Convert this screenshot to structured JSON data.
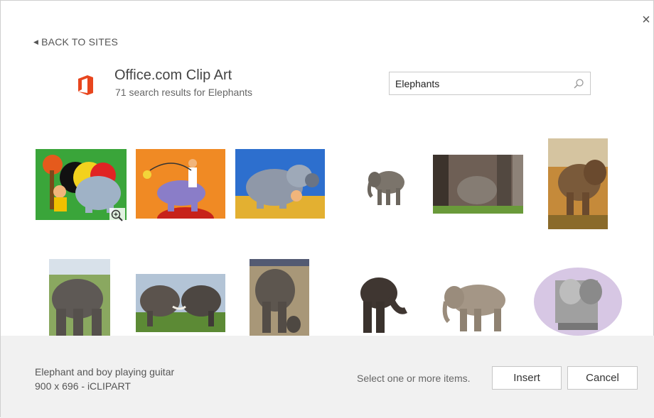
{
  "header": {
    "back_label": "BACK TO SITES",
    "close_symbol": "×",
    "service_title": "Office.com Clip Art",
    "results_summary": "71 search results for Elephants"
  },
  "search": {
    "value": "Elephants",
    "icon": "search-icon"
  },
  "results": [
    {
      "name": "clipart-elephant-boy-guitar",
      "kind": "clipart",
      "selected": true
    },
    {
      "name": "clipart-elephant-rider-orange",
      "kind": "clipart"
    },
    {
      "name": "clipart-elephant-blue-bg",
      "kind": "clipart"
    },
    {
      "name": "photo-elephant-small",
      "kind": "photo"
    },
    {
      "name": "photo-elephant-legs-calf",
      "kind": "photo"
    },
    {
      "name": "photo-elephant-savanna",
      "kind": "photo"
    },
    {
      "name": "photo-elephant-walking",
      "kind": "photo"
    },
    {
      "name": "photo-two-elephants-tusks",
      "kind": "photo"
    },
    {
      "name": "photo-elephant-mother-calf",
      "kind": "photo"
    },
    {
      "name": "photo-elephant-trunk-curl",
      "kind": "photo"
    },
    {
      "name": "photo-elephant-side",
      "kind": "photo"
    },
    {
      "name": "clipart-elephant-statue",
      "kind": "clipart"
    }
  ],
  "footer": {
    "selected_title": "Elephant and boy playing guitar",
    "selected_meta": "900 x 696 - iCLIPART",
    "status": "Select one or more items.",
    "insert_label": "Insert",
    "cancel_label": "Cancel"
  },
  "colors": {
    "office_orange": "#e8461e",
    "footer_bg": "#f1f1f1"
  }
}
